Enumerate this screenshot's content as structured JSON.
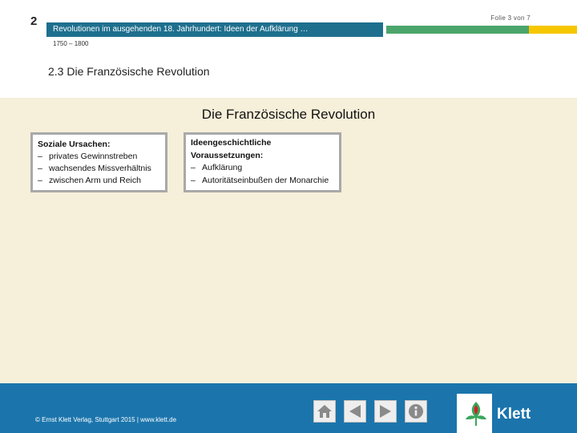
{
  "header": {
    "chapter_number": "2",
    "slide_counter": "Folie 3 von 7",
    "title": "Revolutionen im ausgehenden 18. Jahrhundert: Ideen der Aufklärung …",
    "date_range": "1750 – 1800",
    "section_heading": "2.3 Die Französische Revolution"
  },
  "main": {
    "title": "Die Französische Revolution",
    "boxes": [
      {
        "heading": "Soziale Ursachen:",
        "items": [
          "privates Gewinnstreben",
          "wachsendes Missverhältnis",
          "zwischen Arm und Reich"
        ]
      },
      {
        "heading": "Ideengeschichtliche Voraussetzungen:",
        "items": [
          "Aufklärung",
          "Autoritätseinbußen der Monarchie"
        ]
      }
    ]
  },
  "footer": {
    "copyright": "© Ernst Klett Verlag, Stuttgart 2015 | www.klett.de",
    "nav_icons": [
      "home-icon",
      "back-arrow-icon",
      "forward-arrow-icon",
      "info-icon"
    ],
    "logo_text": "Klett"
  },
  "colors": {
    "header_teal": "#1e6f8e",
    "header_green": "#4ba56b",
    "header_yellow": "#f6c700",
    "content_bg": "#f6efd9",
    "footer_blue": "#1b75ac",
    "logo_green": "#3aa65a",
    "logo_red": "#d6202b"
  }
}
